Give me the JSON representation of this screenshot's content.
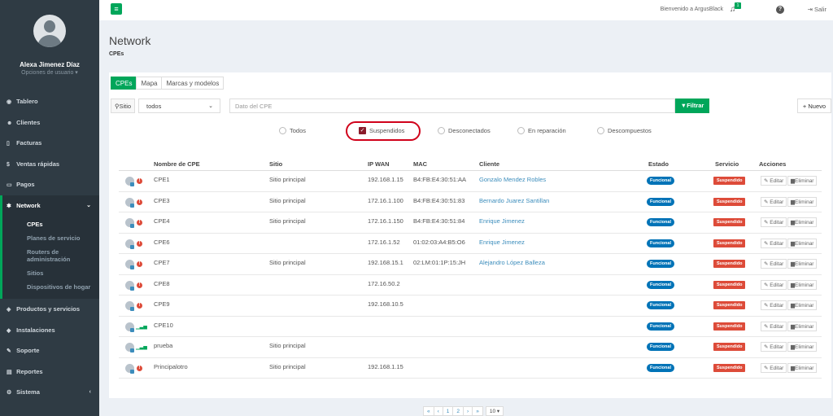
{
  "sidebar": {
    "user_name": "Alexa Jimenez Díaz",
    "user_options": "Opciones de usuario ▾",
    "items": [
      {
        "label": "Tablero",
        "icon": "dashboard-icon"
      },
      {
        "label": "Clientes",
        "icon": "users-icon"
      },
      {
        "label": "Facturas",
        "icon": "invoice-icon"
      },
      {
        "label": "Ventas rápidas",
        "icon": "dollar-icon"
      },
      {
        "label": "Pagos",
        "icon": "card-icon"
      },
      {
        "label": "Network",
        "icon": "network-icon"
      },
      {
        "label": "Productos y servicios",
        "icon": "tag-icon"
      },
      {
        "label": "Instalaciones",
        "icon": "install-icon"
      },
      {
        "label": "Soporte",
        "icon": "wrench-icon"
      },
      {
        "label": "Reportes",
        "icon": "report-icon"
      },
      {
        "label": "Sistema",
        "icon": "gears-icon"
      }
    ],
    "network_sub": [
      "CPEs",
      "Planes de servicio",
      "Routers de administración",
      "Sitios",
      "Dispositivos de hogar"
    ]
  },
  "topbar": {
    "welcome": "Bienvenido a ArgusBlack",
    "notif_count": "1",
    "help": "?",
    "logout": "Salir"
  },
  "page": {
    "title": "Network",
    "subtitle": "CPEs"
  },
  "tabs": [
    "CPEs",
    "Mapa",
    "Marcas y modelos"
  ],
  "filters": {
    "site_label": "Sitio",
    "site_value": "todos",
    "cpe_placeholder": "Dato del CPE",
    "filter_button": "Filtrar",
    "new_button": "Nuevo"
  },
  "status_options": [
    "Todos",
    "Suspendidos",
    "Desconectados",
    "En reparación",
    "Descompuestos"
  ],
  "table": {
    "headers": [
      "Nombre de CPE",
      "Sitio",
      "IP WAN",
      "MAC",
      "Cliente",
      "Estado",
      "Servicio",
      "Acciones"
    ],
    "rows": [
      {
        "name": "CPE1",
        "site": "Sitio principal",
        "ip": "192.168.1.15",
        "mac": "B4:FB:E4:30:51:AA",
        "client": "Gonzalo Mendez Robles",
        "state": "Funcional",
        "service": "Suspendido",
        "icon": "warn"
      },
      {
        "name": "CPE3",
        "site": "Sitio principal",
        "ip": "172.16.1.100",
        "mac": "B4:FB:E4:30:51:83",
        "client": "Bernardo Juarez Santillan",
        "state": "Funcional",
        "service": "Suspendido",
        "icon": "warn"
      },
      {
        "name": "CPE4",
        "site": "Sitio principal",
        "ip": "172.16.1.150",
        "mac": "B4:FB:E4:30:51:84",
        "client": "Enrique Jimenez",
        "state": "Funcional",
        "service": "Suspendido",
        "icon": "warn"
      },
      {
        "name": "CPE6",
        "site": "",
        "ip": "172.16.1.52",
        "mac": "01:02:03:A4:B5:O6",
        "client": "Enrique Jimenez",
        "state": "Funcional",
        "service": "Suspendido",
        "icon": "warn"
      },
      {
        "name": "CPE7",
        "site": "Sitio principal",
        "ip": "192.168.15.1",
        "mac": "02:LM:01:1P:15:JH",
        "client": "Alejandro López Balleza",
        "state": "Funcional",
        "service": "Suspendido",
        "icon": "warn"
      },
      {
        "name": "CPE8",
        "site": "",
        "ip": "172.16.50.2",
        "mac": "",
        "client": "",
        "state": "Funcional",
        "service": "Suspendido",
        "icon": "warn"
      },
      {
        "name": "CPE9",
        "site": "",
        "ip": "192.168.10.5",
        "mac": "",
        "client": "",
        "state": "Funcional",
        "service": "Suspendido",
        "icon": "warn"
      },
      {
        "name": "CPE10",
        "site": "",
        "ip": "",
        "mac": "",
        "client": "",
        "state": "Funcional",
        "service": "Suspendido",
        "icon": "signal"
      },
      {
        "name": "prueba",
        "site": "Sitio principal",
        "ip": "",
        "mac": "",
        "client": "",
        "state": "Funcional",
        "service": "Suspendido",
        "icon": "signal"
      },
      {
        "name": "Principalotro",
        "site": "Sitio principal",
        "ip": "192.168.1.15",
        "mac": "",
        "client": "",
        "state": "Funcional",
        "service": "Suspendido",
        "icon": "warn"
      }
    ],
    "edit_label": "Editar",
    "delete_label": "Eliminar"
  },
  "pager": {
    "items": [
      "«",
      "‹",
      "1",
      "2",
      "›",
      "»"
    ],
    "page_size": "10 ▾"
  },
  "colors": {
    "accent": "#00a65a",
    "sidebar": "#2f3b44",
    "functional": "#0073b7",
    "suspended": "#dd4b39",
    "highlight": "#d0021b"
  }
}
